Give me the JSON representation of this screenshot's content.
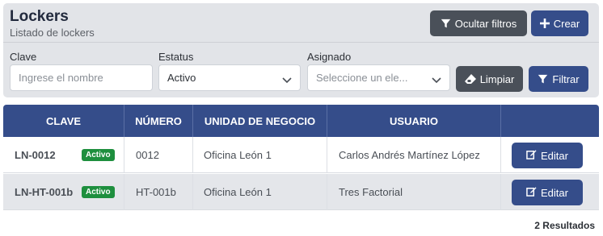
{
  "header": {
    "title": "Lockers",
    "subtitle": "Listado de lockers",
    "hide_filters_label": "Ocultar filtros",
    "create_label": "Crear"
  },
  "filters": {
    "clave": {
      "label": "Clave",
      "placeholder": "Ingrese el nombre"
    },
    "estatus": {
      "label": "Estatus",
      "value": "Activo"
    },
    "asignado": {
      "label": "Asignado",
      "placeholder": "Seleccione un ele..."
    },
    "clear_label": "Limpiar",
    "filter_label": "Filtrar"
  },
  "table": {
    "columns": [
      "CLAVE",
      "NÚMERO",
      "UNIDAD DE NEGOCIO",
      "USUARIO"
    ],
    "rows": [
      {
        "clave": "LN-0012",
        "badge": "Activo",
        "numero": "0012",
        "unidad": "Oficina León 1",
        "usuario": "Carlos Andrés Martínez López",
        "action": "Editar"
      },
      {
        "clave": "LN-HT-001b",
        "badge": "Activo",
        "numero": "HT-001b",
        "unidad": "Oficina León 1",
        "usuario": "Tres Factorial",
        "action": "Editar"
      }
    ]
  },
  "results_text": "2 Resultados",
  "colors": {
    "primary": "#354d8a",
    "secondary": "#4a5059",
    "success": "#1e8f3e"
  }
}
